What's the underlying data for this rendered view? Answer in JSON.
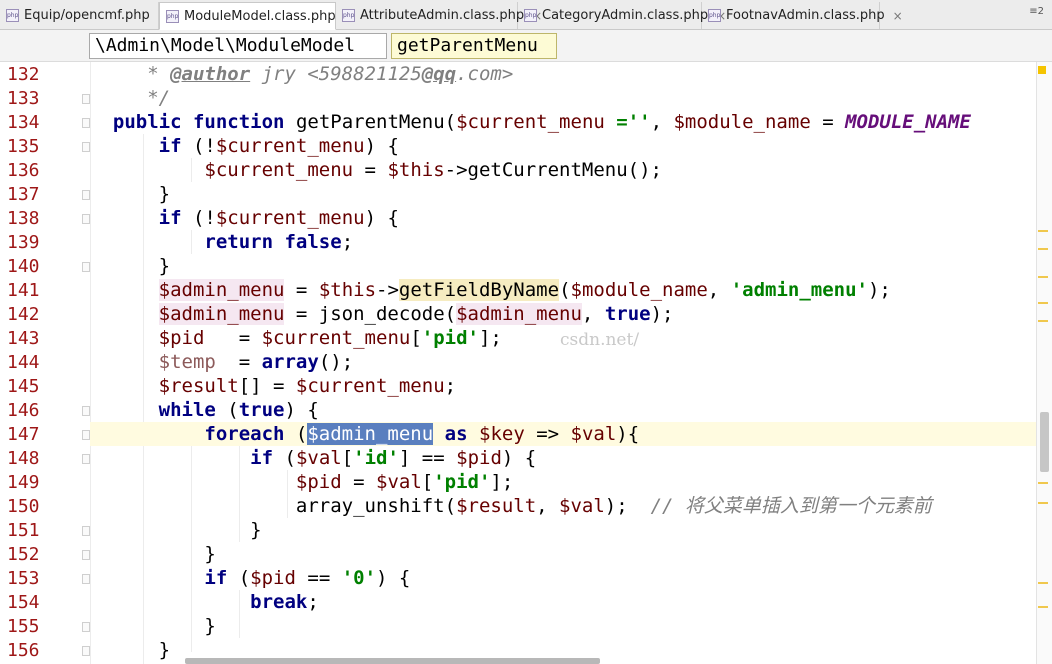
{
  "tabs": [
    {
      "icon": "php-file-icon",
      "label": "Equip/opencmf.php",
      "close": "×"
    },
    {
      "icon": "php-file-icon",
      "label": "ModuleModel.class.php",
      "close": "×",
      "active": true
    },
    {
      "icon": "php-file-icon",
      "label": "AttributeAdmin.class.php",
      "close": "×"
    },
    {
      "icon": "php-file-icon",
      "label": "CategoryAdmin.class.php",
      "close": "×"
    },
    {
      "icon": "php-file-icon",
      "label": "FootnavAdmin.class.php",
      "close": "×"
    }
  ],
  "tab_overflow": "≡2",
  "breadcrumb": {
    "class_path": "\\Admin\\Model\\ModuleModel",
    "method": "getParentMenu"
  },
  "line_numbers": [
    "132",
    "133",
    "134",
    "135",
    "136",
    "137",
    "138",
    "139",
    "140",
    "141",
    "142",
    "143",
    "144",
    "145",
    "146",
    "147",
    "148",
    "149",
    "150",
    "151",
    "152",
    "153",
    "154",
    "155",
    "156"
  ],
  "current_line": "147",
  "code": {
    "l132": {
      "star": " * ",
      "tag": "@author",
      "rest": " jry <598821125",
      "at": "@qq",
      "dom": ".com>"
    },
    "l133": " */",
    "l134": {
      "kw1": "public",
      "kw2": "function",
      "name": "getParentMenu(",
      "v1": "$current_menu",
      "eq": " =''",
      "comma": ", ",
      "v2": "$module_name",
      "eq2": " = ",
      "const": "MODULE_NAME"
    },
    "l135": {
      "kw": "if",
      "open": " (!",
      "v": "$current_menu",
      "close": ") {"
    },
    "l136": {
      "v": "$current_menu",
      "mid": " = ",
      "this": "$this",
      "call": "->getCurrentMenu();"
    },
    "l137": "}",
    "l138": {
      "kw": "if",
      "open": " (!",
      "v": "$current_menu",
      "close": ") {"
    },
    "l139": {
      "kw": "return",
      "sp": " ",
      "kw2": "false",
      "end": ";"
    },
    "l140": "}",
    "l141": {
      "v": "$admin_menu",
      "mid": " = ",
      "this": "$this",
      "arrow": "->",
      "fn": "getFieldByName",
      "open": "(",
      "v2": "$module_name",
      "comma": ", ",
      "str": "'admin_menu'",
      "end": ");"
    },
    "l142": {
      "v": "$admin_menu",
      "mid": " = json_decode(",
      "v2": "$admin_menu",
      "comma": ", ",
      "kw": "true",
      "end": ");"
    },
    "l143": {
      "v": "$pid",
      "mid": "   = ",
      "v2": "$current_menu",
      "open": "[",
      "str": "'pid'",
      "end": "];"
    },
    "l144": {
      "v": "$temp",
      "mid": "  = ",
      "kw": "array",
      "end": "();"
    },
    "l145": {
      "v": "$result",
      "mid": "[] = ",
      "v2": "$current_menu",
      "end": ";"
    },
    "l146": {
      "kw": "while",
      "open": " (",
      "kw2": "true",
      "end": ") {"
    },
    "l147": {
      "kw": "foreach",
      "open": " (",
      "sel": "$admin_menu",
      "sp": " ",
      "kw2": "as",
      "sp2": " ",
      "v2": "$key",
      "arrow": " => ",
      "v3": "$val",
      "end": "){"
    },
    "l148": {
      "kw": "if",
      "open": " (",
      "v": "$val",
      "b1": "[",
      "str": "'id'",
      "b2": "] == ",
      "v2": "$pid",
      "end": ") {"
    },
    "l149": {
      "v": "$pid",
      "mid": " = ",
      "v2": "$val",
      "b1": "[",
      "str": "'pid'",
      "end": "];"
    },
    "l150": {
      "fn": "array_unshift(",
      "v": "$result",
      "comma": ", ",
      "v2": "$val",
      "end": ");  ",
      "cmt": "// 将父菜单插入到第一个元素前"
    },
    "l151": "}",
    "l152": "}",
    "l153": {
      "kw": "if",
      "open": " (",
      "v": "$pid",
      "mid": " == ",
      "str": "'0'",
      "end": ") {"
    },
    "l154": {
      "kw": "break",
      "end": ";"
    },
    "l155": "}",
    "l156": "}"
  },
  "watermark": "csdn.net/"
}
